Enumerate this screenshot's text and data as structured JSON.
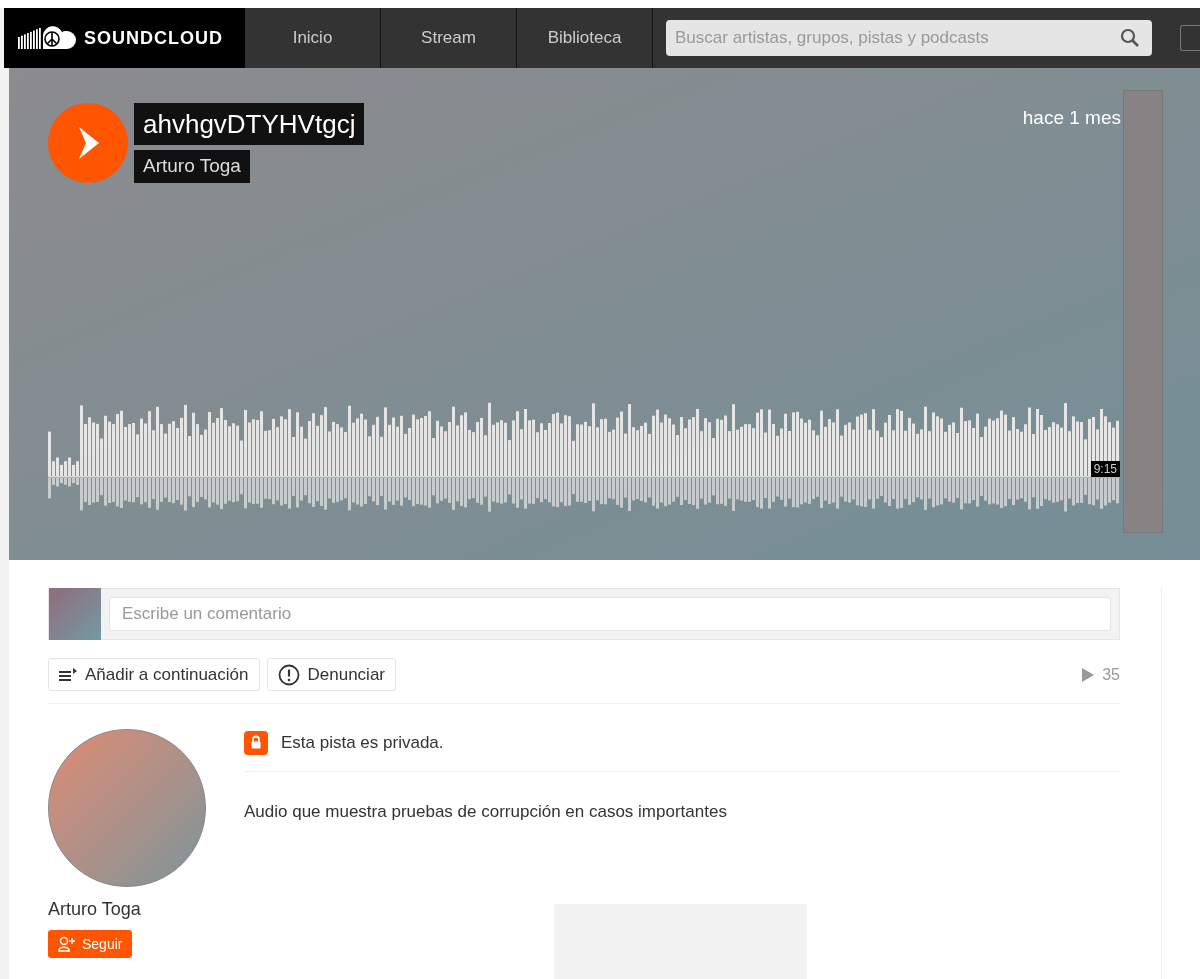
{
  "header": {
    "logo": "SOUNDCLOUD",
    "nav": [
      {
        "label": "Inicio",
        "selected": false
      },
      {
        "label": "Stream",
        "selected": false
      },
      {
        "label": "Biblioteca",
        "selected": false
      }
    ],
    "search": {
      "placeholder": "Buscar artistas, grupos, pistas y podcasts"
    }
  },
  "track": {
    "title": "ahvhgvDTYHVtgcj",
    "artist": "Arturo Toga",
    "posted": "hace 1 mes",
    "duration": "9:15"
  },
  "comment": {
    "placeholder": "Escribe un comentario"
  },
  "actions": [
    {
      "kind": "queue",
      "label": "Añadir a continuación"
    },
    {
      "kind": "report",
      "label": "Denunciar"
    }
  ],
  "plays": "35",
  "uploader": {
    "name": "Arturo Toga",
    "follow": "Seguir"
  },
  "privacy": {
    "private": true,
    "text": "Esta pista es privada."
  },
  "description": "Audio que muestra pruebas de corrupción en casos importantes"
}
